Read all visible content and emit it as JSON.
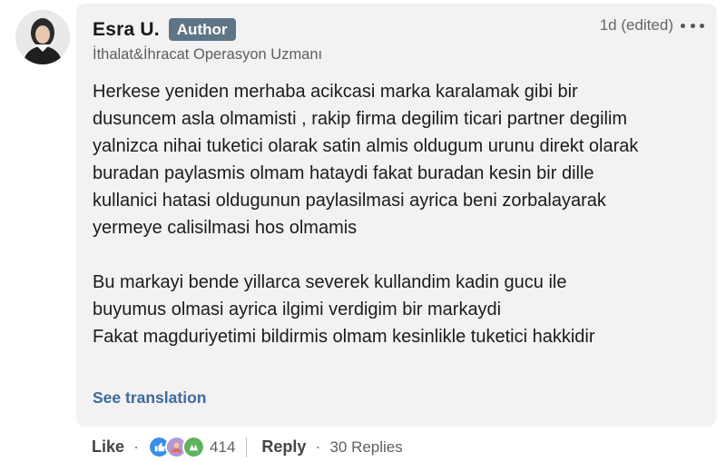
{
  "comment": {
    "author": {
      "name": "Esra U.",
      "badge": "Author",
      "headline": "İthalat&İhracat Operasyon Uzmanı"
    },
    "timestamp": "1d (edited)",
    "body": "Herkese yeniden merhaba acikcasi marka karalamak gibi bir\ndusuncem asla olmamisti , rakip firma degilim ticari partner degilim\nyalnizca nihai tuketici olarak satin almis oldugum urunu direkt olarak\nburadan paylasmis olmam hataydi fakat buradan kesin bir dille\nkullanici hatasi oldugunun paylasilmasi ayrica beni zorbalayarak\nyermeye calisilmasi hos olmamis\n\nBu markayi bende yillarca severek kullandim kadin gucu ile\nbuyumus olmasi ayrica ilgimi verdigim bir markaydi\nFakat magduriyetimi bildirmis olmam kesinlikle tuketici hakkidir",
    "see_translation": "See translation"
  },
  "actions": {
    "like": "Like",
    "separator": "·",
    "reaction_icons": [
      "like-reaction-icon",
      "support-reaction-icon",
      "celebrate-reaction-icon"
    ],
    "reaction_count": "414",
    "reply": "Reply",
    "replies": "30 Replies"
  },
  "colors": {
    "badge": "#5f7585",
    "link": "#3b6aa0",
    "box": "#f2f2f2"
  }
}
